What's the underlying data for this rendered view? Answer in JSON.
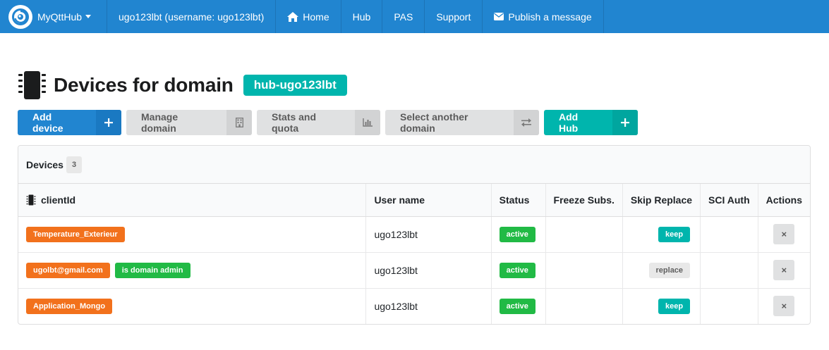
{
  "navbar": {
    "brand": "MyQttHub",
    "user": "ugo123lbt (username: ugo123lbt)",
    "links": [
      {
        "label": "Home",
        "icon": "home-icon"
      },
      {
        "label": "Hub"
      },
      {
        "label": "PAS"
      },
      {
        "label": "Support"
      },
      {
        "label": "Publish a message",
        "icon": "envelope-icon"
      }
    ]
  },
  "header": {
    "title": "Devices for domain",
    "domain": "hub-ugo123lbt",
    "icon": "microchip-icon"
  },
  "buttons": {
    "add_device": "Add device",
    "manage_domain": "Manage domain",
    "stats_quota": "Stats and quota",
    "select_domain": "Select another domain",
    "add_hub": "Add Hub"
  },
  "table": {
    "title": "Devices",
    "count": "3",
    "columns": [
      "clientId",
      "User name",
      "Status",
      "Freeze Subs.",
      "Skip Replace",
      "SCI Auth",
      "Actions"
    ],
    "rows": [
      {
        "client_id": "Temperature_Exterieur",
        "extra": "",
        "user": "ugo123lbt",
        "status": "active",
        "skip_replace": "keep",
        "action": "×"
      },
      {
        "client_id": "ugolbt@gmail.com",
        "extra": "is domain admin",
        "user": "ugo123lbt",
        "status": "active",
        "skip_replace": "replace",
        "action": "×"
      },
      {
        "client_id": "Application_Mongo",
        "extra": "",
        "user": "ugo123lbt",
        "status": "active",
        "skip_replace": "keep",
        "action": "×"
      }
    ]
  },
  "colors": {
    "primary": "#2185d0",
    "teal": "#00b5ad",
    "orange": "#f2711c",
    "green": "#21ba45",
    "grey": "#e0e1e2"
  }
}
